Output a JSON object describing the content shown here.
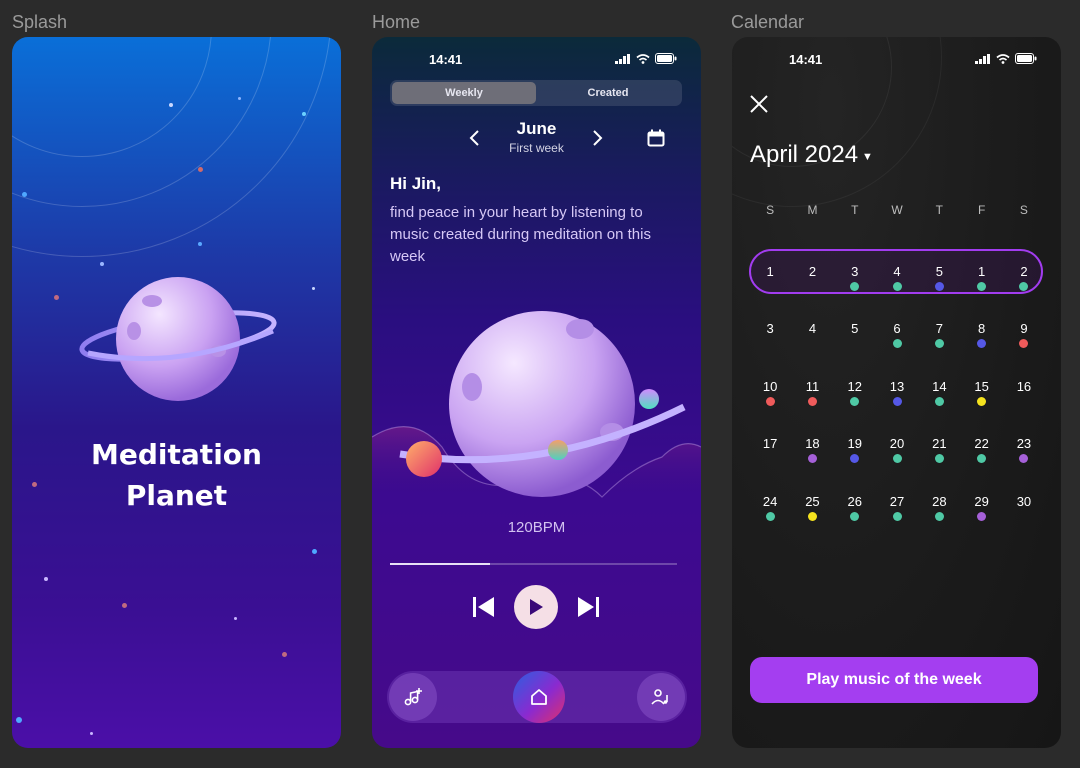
{
  "frames": {
    "splash_label": "Splash",
    "home_label": "Home",
    "calendar_label": "Calendar"
  },
  "splash": {
    "title_line1": "Meditation",
    "title_line2": "Planet"
  },
  "home": {
    "status_time": "14:41",
    "segments": [
      {
        "label": "Weekly",
        "active": true
      },
      {
        "label": "Created",
        "active": false
      }
    ],
    "month": "June",
    "week": "First week",
    "greeting": "Hi Jin,",
    "message": "find peace in your heart by listening to music created during meditation on this week",
    "bpm": "120BPM",
    "progress": 0.35,
    "icons": {
      "prev": "chevron-left-icon",
      "next": "chevron-right-icon",
      "calendar": "calendar-icon",
      "skip_back": "skip-back-icon",
      "play": "play-icon",
      "skip_forward": "skip-forward-icon",
      "add_music": "add-music-icon",
      "home": "home-icon",
      "profile": "profile-music-icon"
    }
  },
  "calendar": {
    "status_time": "14:41",
    "title": "April 2024",
    "weekdays": [
      "S",
      "M",
      "T",
      "W",
      "T",
      "F",
      "S"
    ],
    "weeks": [
      [
        {
          "d": "1",
          "c": ""
        },
        {
          "d": "2",
          "c": ""
        },
        {
          "d": "3",
          "c": "#4fc9a5"
        },
        {
          "d": "4",
          "c": "#4fc9a5"
        },
        {
          "d": "5",
          "c": "#5558e6"
        },
        {
          "d": "1",
          "c": "#4fc9a5"
        },
        {
          "d": "2",
          "c": "#4fc9a5"
        }
      ],
      [
        {
          "d": "3",
          "c": ""
        },
        {
          "d": "4",
          "c": ""
        },
        {
          "d": "5",
          "c": ""
        },
        {
          "d": "6",
          "c": "#4fc9a5"
        },
        {
          "d": "7",
          "c": "#4fc9a5"
        },
        {
          "d": "8",
          "c": "#5558e6"
        },
        {
          "d": "9",
          "c": "#ef5b5b"
        }
      ],
      [
        {
          "d": "10",
          "c": "#ef5b5b"
        },
        {
          "d": "11",
          "c": "#ef5b5b"
        },
        {
          "d": "12",
          "c": "#4fc9a5"
        },
        {
          "d": "13",
          "c": "#5558e6"
        },
        {
          "d": "14",
          "c": "#4fc9a5"
        },
        {
          "d": "15",
          "c": "#f5e31e"
        },
        {
          "d": "16",
          "c": ""
        }
      ],
      [
        {
          "d": "17",
          "c": ""
        },
        {
          "d": "18",
          "c": "#a560d8"
        },
        {
          "d": "19",
          "c": "#5558e6"
        },
        {
          "d": "20",
          "c": "#4fc9a5"
        },
        {
          "d": "21",
          "c": "#4fc9a5"
        },
        {
          "d": "22",
          "c": "#4fc9a5"
        },
        {
          "d": "23",
          "c": "#a560d8"
        }
      ],
      [
        {
          "d": "24",
          "c": "#4fc9a5"
        },
        {
          "d": "25",
          "c": "#f5e31e"
        },
        {
          "d": "26",
          "c": "#4fc9a5"
        },
        {
          "d": "27",
          "c": "#4fc9a5"
        },
        {
          "d": "28",
          "c": "#4fc9a5"
        },
        {
          "d": "29",
          "c": "#a560d8"
        },
        {
          "d": "30",
          "c": ""
        }
      ]
    ],
    "cta": "Play music of the week",
    "accent": "#a43ef0"
  }
}
